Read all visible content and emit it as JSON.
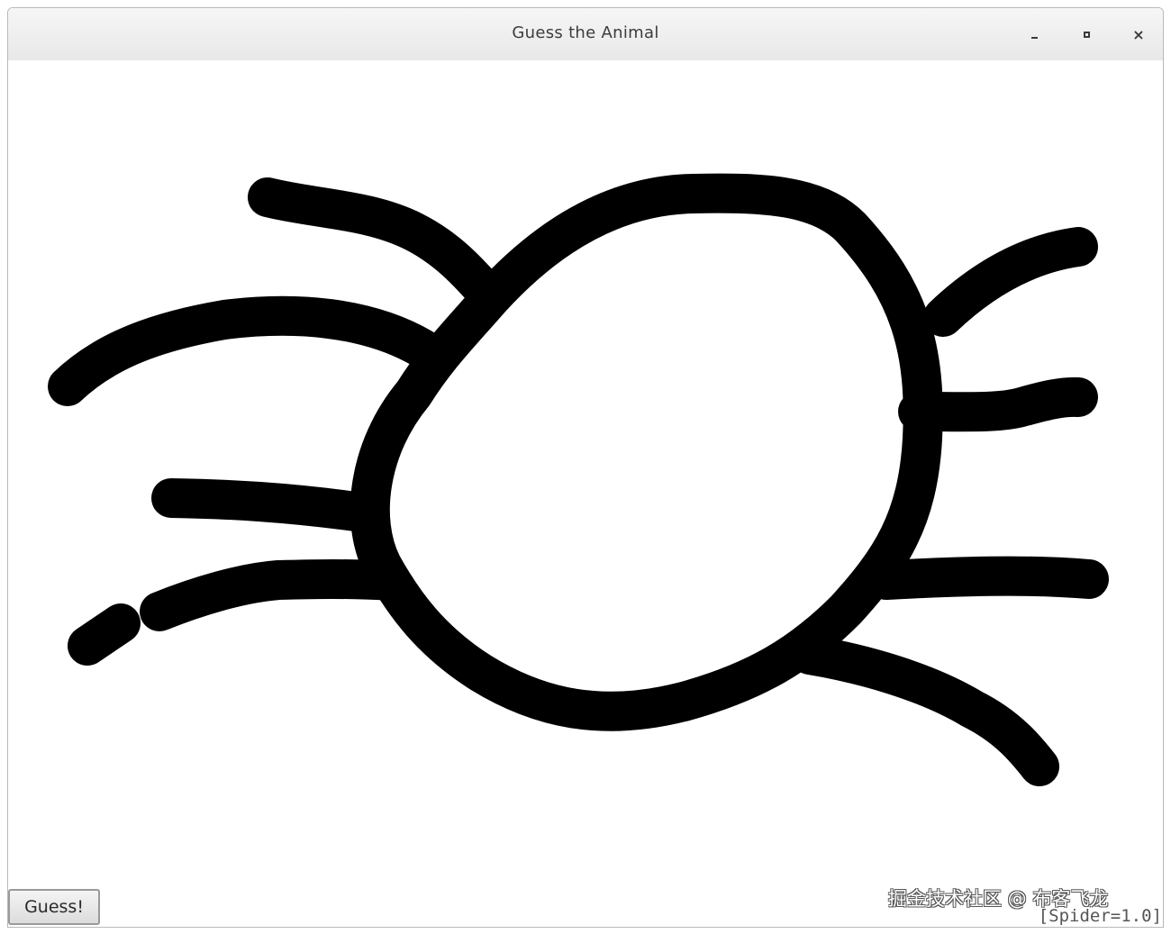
{
  "window": {
    "title": "Guess the Animal",
    "controls": {
      "minimize": "minimize-icon",
      "maximize": "maximize-icon",
      "close": "close-icon",
      "close_glyph": "×"
    }
  },
  "canvas": {
    "stroke_color": "#000000",
    "background": "#ffffff"
  },
  "actions": {
    "guess_label": "Guess!"
  },
  "result_label": "[Spider=1.0]",
  "watermark": "掘金技术社区 @ 布客飞龙"
}
